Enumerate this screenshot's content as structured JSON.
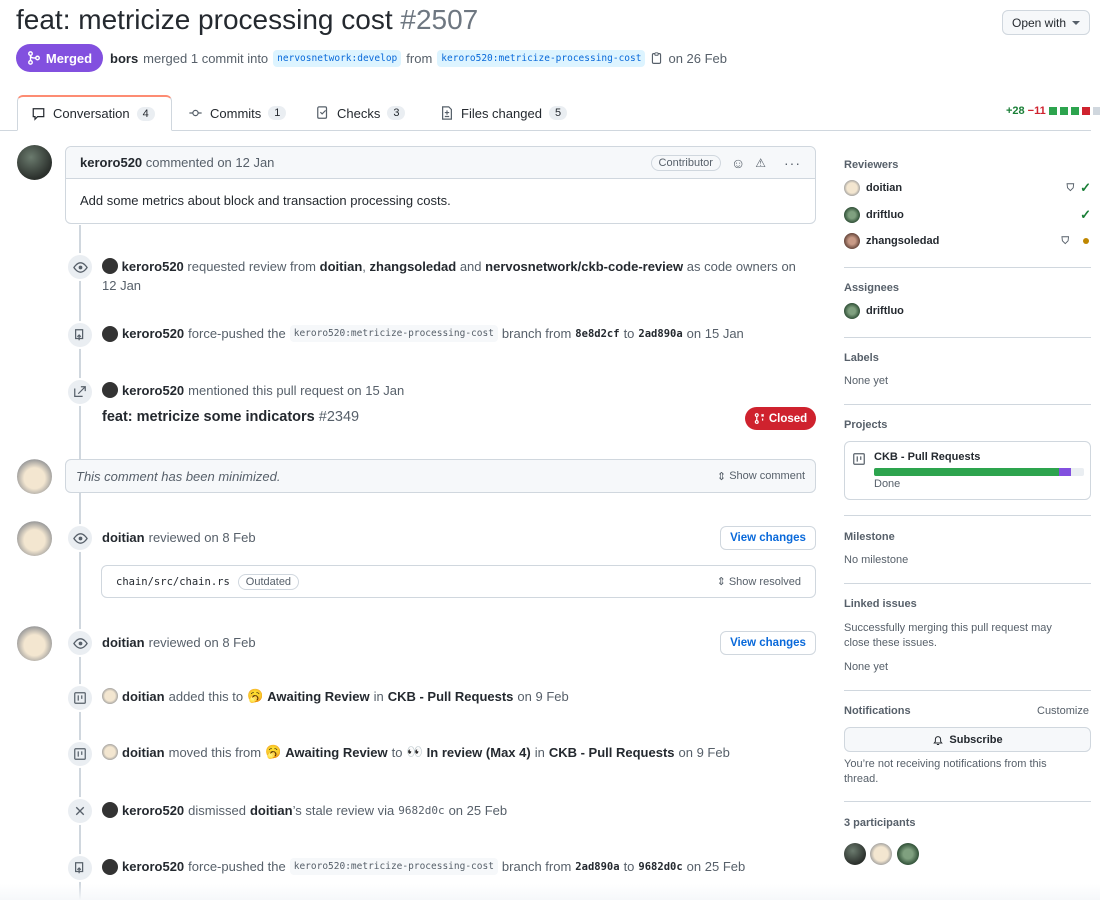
{
  "pr": {
    "title": "feat: metricize processing cost",
    "number": "#2507",
    "state": "Merged",
    "merged_by": "bors",
    "merge_text": "merged 1 commit into",
    "base": "nervosnetwork:develop",
    "from_word": "from",
    "head": "keroro520:metricize-processing-cost",
    "date": "on 26 Feb",
    "open_with": "Open with"
  },
  "tabs": [
    {
      "label": "Conversation",
      "count": "4"
    },
    {
      "label": "Commits",
      "count": "1"
    },
    {
      "label": "Checks",
      "count": "3"
    },
    {
      "label": "Files changed",
      "count": "5"
    }
  ],
  "diffstat": {
    "additions": "+28",
    "deletions": "−11"
  },
  "comment": {
    "author": "keroro520",
    "action": "commented on 12 Jan",
    "role": "Contributor",
    "body": "Add some metrics about block and transaction processing costs."
  },
  "events": {
    "e1": {
      "user": "keroro520",
      "t1": "requested review from",
      "r1": "doitian",
      "sep": ",",
      "r2": "zhangsoledad",
      "and": "and",
      "r3": "nervosnetwork/ckb-code-review",
      "tail": "as code owners",
      "date": "on 12 Jan"
    },
    "e2": {
      "user": "keroro520",
      "t1": "force-pushed the",
      "branch": "keroro520:metricize-processing-cost",
      "t2": "branch from",
      "from": "8e8d2cf",
      "to_word": "to",
      "to": "2ad890a",
      "date": "on 15 Jan"
    },
    "e3": {
      "user": "keroro520",
      "t1": "mentioned this pull request on 15 Jan",
      "ref_title": "feat: metricize some indicators",
      "ref_num": "#2349",
      "ref_state": "Closed"
    },
    "minimized": {
      "text": "This comment has been minimized.",
      "action": "Show comment"
    },
    "r1": {
      "user": "doitian",
      "t1": "reviewed on 8 Feb",
      "button": "View changes",
      "file": "chain/src/chain.rs",
      "badge": "Outdated",
      "action": "Show resolved"
    },
    "r2": {
      "user": "doitian",
      "t1": "reviewed on 8 Feb",
      "button": "View changes"
    },
    "e4": {
      "user": "doitian",
      "t1": "added this to",
      "emoji": "🥱",
      "col": "Awaiting Review",
      "in": "in",
      "project": "CKB - Pull Requests",
      "date": "on 9 Feb"
    },
    "e5": {
      "user": "doitian",
      "t1": "moved this from",
      "emoji1": "🥱",
      "col1": "Awaiting Review",
      "to": "to",
      "emoji2": "👀",
      "col2": "In review (Max 4)",
      "in": "in",
      "project": "CKB - Pull Requests",
      "date": "on 9 Feb"
    },
    "e6": {
      "user": "keroro520",
      "t1": "dismissed",
      "who": "doitian",
      "t2": "’s stale review via",
      "sha": "9682d0c",
      "date": "on 25 Feb"
    },
    "e7": {
      "user": "keroro520",
      "t1": "force-pushed the",
      "branch": "keroro520:metricize-processing-cost",
      "t2": "branch from",
      "from": "2ad890a",
      "to_word": "to",
      "to": "9682d0c",
      "date": "on 25 Feb"
    }
  },
  "sidebar": {
    "reviewers_title": "Reviewers",
    "reviewers": [
      {
        "name": "doitian",
        "status": "approved"
      },
      {
        "name": "driftluo",
        "status": "approved"
      },
      {
        "name": "zhangsoledad",
        "status": "pending"
      }
    ],
    "assignees_title": "Assignees",
    "assignee": "driftluo",
    "labels_title": "Labels",
    "labels_value": "None yet",
    "projects_title": "Projects",
    "project_name": "CKB - Pull Requests",
    "project_status": "Done",
    "project_progress_done": 0.88,
    "project_progress_inprogress": 0.06,
    "milestone_title": "Milestone",
    "milestone_value": "No milestone",
    "linked_title": "Linked issues",
    "linked_desc": "Successfully merging this pull request may close these issues.",
    "linked_value": "None yet",
    "notifications_title": "Notifications",
    "customize": "Customize",
    "subscribe": "Subscribe",
    "notif_desc": "You’re not receiving notifications from this thread.",
    "participants_title": "3 participants"
  },
  "colors": {
    "merged": "#8250df",
    "closed": "#cf222e",
    "link": "#0969da",
    "green": "#1a7f37"
  }
}
